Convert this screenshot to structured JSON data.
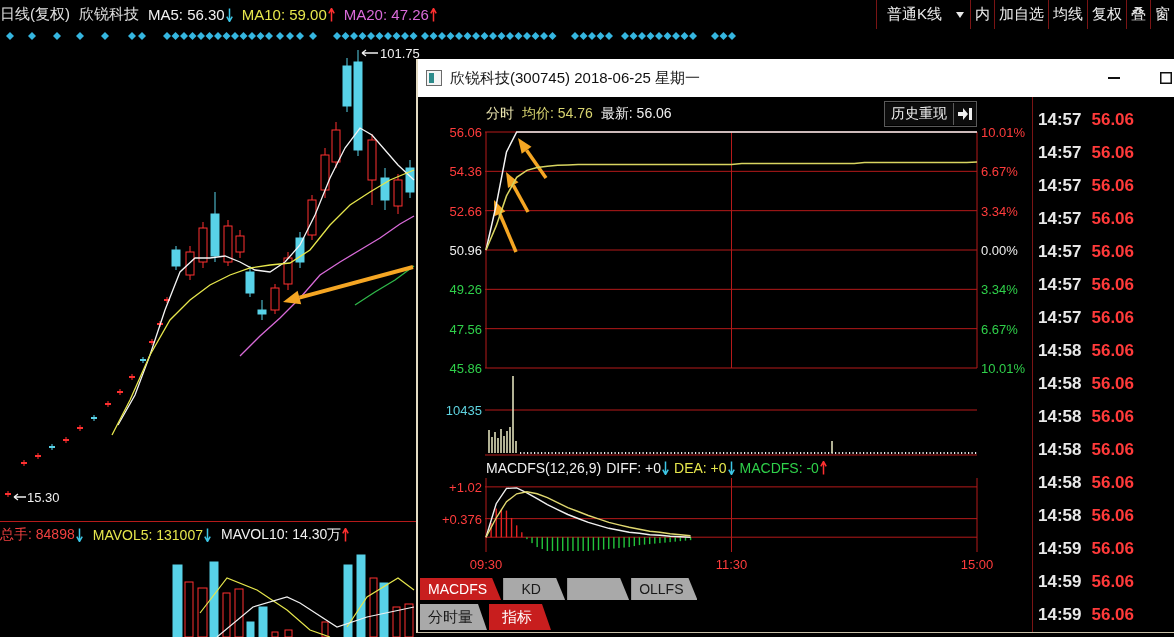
{
  "header": {
    "period": "日线(复权)",
    "stock": "欣锐科技",
    "indicators": [
      {
        "label": "MA5: 56.30",
        "rising": false,
        "color": "#f0f0f0"
      },
      {
        "label": "MA10: 59.00",
        "rising": true,
        "color": "#e6e64c"
      },
      {
        "label": "MA20: 47.26",
        "rising": true,
        "color": "#d86ad8"
      }
    ]
  },
  "toolbar": [
    {
      "label": "普通K线",
      "kind": "dropdown"
    },
    {
      "label": "内",
      "kind": "button"
    },
    {
      "label": "加自选",
      "kind": "button"
    },
    {
      "label": "均线",
      "kind": "button"
    },
    {
      "label": "复权",
      "kind": "button"
    },
    {
      "label": "叠",
      "kind": "button"
    },
    {
      "label": "窗",
      "kind": "button"
    }
  ],
  "kline": {
    "high_label": "101.75",
    "low_label": "15.30"
  },
  "volume": {
    "indicators": [
      {
        "label": "总手: 84898",
        "rising": false,
        "color": "#f04040"
      },
      {
        "label": "MAVOL5: 131007",
        "rising": false,
        "color": "#e6e64c"
      },
      {
        "label": "MAVOL10: 14.30万",
        "rising": true,
        "color": "#f0f0f0"
      }
    ]
  },
  "popup": {
    "title": "欣锐科技(300745) 2018-06-25 星期一",
    "summary": {
      "mode": "分时",
      "average": "均价: 54.76",
      "latest": "最新: 56.06"
    },
    "replay_button": "历史重现",
    "price_chart": {
      "chart_data": {
        "type": "line",
        "categories": [
          null,
          null,
          null,
          null,
          null,
          null,
          null,
          null,
          null,
          null,
          null,
          null,
          null,
          null,
          null,
          null,
          null,
          null,
          null,
          null,
          null,
          null,
          null,
          null,
          null,
          null,
          null,
          null,
          null,
          null,
          null,
          null,
          null,
          null,
          null,
          null,
          null,
          null,
          null,
          null,
          null,
          null,
          null,
          null,
          null,
          null,
          null,
          null,
          null
        ],
        "series": [
          {
            "color": "#f4f4f4",
            "values": [
              50.96,
              52.9,
              55.2,
              56.06,
              56.06,
              56.06,
              56.06,
              56.06,
              56.06,
              56.06,
              56.06,
              56.06,
              56.06,
              56.06,
              56.06,
              56.06,
              56.06,
              56.06,
              56.06,
              56.06,
              56.06,
              56.06,
              56.06,
              56.06,
              56.06,
              56.06,
              56.06,
              56.06,
              56.06,
              56.06,
              56.06,
              56.06,
              56.06,
              56.06,
              56.06,
              56.06,
              56.06,
              56.06,
              56.06,
              56.06,
              56.06,
              56.06,
              56.06,
              56.06,
              56.06,
              56.06,
              56.06,
              56.06,
              56.06
            ]
          },
          {
            "color": "#d8d460",
            "values": [
              50.96,
              52.0,
              53.3,
              54.1,
              54.4,
              54.52,
              54.58,
              54.62,
              54.64,
              54.66,
              54.66,
              54.66,
              54.66,
              54.66,
              54.66,
              54.66,
              54.66,
              54.66,
              54.66,
              54.66,
              54.66,
              54.66,
              54.66,
              54.66,
              54.66,
              54.7,
              54.7,
              54.7,
              54.7,
              54.7,
              54.7,
              54.7,
              54.7,
              54.7,
              54.7,
              54.7,
              54.7,
              54.74,
              54.74,
              54.74,
              54.74,
              54.74,
              54.74,
              54.74,
              54.74,
              54.74,
              54.74,
              54.74,
              54.76
            ]
          }
        ],
        "ylim": [
          45.86,
          56.06
        ],
        "yticks": [
          {
            "value": 56.06,
            "label": "56.06"
          },
          {
            "value": 54.36,
            "label": "54.36"
          },
          {
            "value": 52.66,
            "label": "52.66"
          },
          {
            "value": 50.96,
            "label": "50.96"
          },
          {
            "value": 49.26,
            "label": "49.26"
          },
          {
            "value": 47.56,
            "label": "47.56"
          },
          {
            "value": 45.86,
            "label": "45.86"
          }
        ],
        "grid": true
      },
      "change_labels": [
        "10.01%",
        "6.67%",
        "3.34%",
        "0.00%",
        "3.34%",
        "6.67%",
        "10.01%"
      ]
    },
    "volume_pane": {
      "max_label": "10435"
    },
    "macd": {
      "legend": [
        {
          "label": "MACDFS(12,26,9)",
          "color": "#f0f0f0"
        },
        {
          "label": "DIFF: +0",
          "rising": false,
          "color": "#f0f0f0"
        },
        {
          "label": "DEA: +0",
          "rising": false,
          "color": "#e6e64c"
        },
        {
          "label": "MACDFS: -0",
          "rising": true,
          "color": "#2fd04a"
        }
      ],
      "chart_data": {
        "type": "line",
        "categories": [
          "09:30",
          null,
          null,
          null,
          null,
          null,
          null,
          null,
          null,
          null,
          null,
          null,
          null,
          null,
          null,
          null,
          null,
          null,
          null,
          null,
          null,
          null,
          null,
          null,
          "11:30",
          null,
          null,
          null,
          null,
          null,
          null,
          null,
          null,
          null,
          null,
          null,
          null,
          null,
          null,
          null,
          null,
          null,
          null,
          null,
          null,
          null,
          null,
          null,
          "15:00"
        ],
        "series": [
          {
            "color": "#f0f0f0",
            "values": [
              0,
              0.68,
              0.99,
              1.0,
              0.9,
              0.78,
              0.66,
              0.56,
              0.46,
              0.38,
              0.3,
              0.24,
              0.18,
              0.14,
              0.1,
              0.08,
              0.05,
              0.04,
              0.02,
              0.01,
              0,
              null,
              null,
              null,
              null,
              null,
              null,
              null,
              null,
              null,
              null,
              null,
              null,
              null,
              null,
              null,
              null,
              null,
              null,
              null,
              null,
              null,
              null,
              null,
              null,
              null,
              null,
              null,
              null
            ]
          },
          {
            "color": "#e0d870",
            "values": [
              0,
              0.39,
              0.72,
              0.88,
              0.92,
              0.88,
              0.8,
              0.7,
              0.6,
              0.52,
              0.44,
              0.37,
              0.3,
              0.25,
              0.2,
              0.16,
              0.12,
              0.1,
              0.07,
              0.05,
              0.03,
              null,
              null,
              null,
              null,
              null,
              null,
              null,
              null,
              null,
              null,
              null,
              null,
              null,
              null,
              null,
              null,
              null,
              null,
              null,
              null,
              null,
              null,
              null,
              null,
              null,
              null,
              null,
              null
            ]
          }
        ],
        "ylim": [
          -0.3,
          1.2
        ],
        "yticks": [
          {
            "value": 1.02,
            "label": "+1.02"
          },
          {
            "value": 0.376,
            "label": "+0.376"
          }
        ],
        "grid": true
      }
    },
    "indicator_tabs": [
      {
        "label": "MACDFS",
        "selected": true
      },
      {
        "label": "KD",
        "selected": false
      },
      {
        "selected": false
      },
      {
        "label": "OLLFS",
        "selected": false
      }
    ],
    "pane_tabs": [
      {
        "label": "分时量",
        "selected": false
      },
      {
        "label": "指标",
        "selected": true
      }
    ],
    "ticks": [
      {
        "time": "14:57",
        "price": "56.06"
      },
      {
        "time": "14:57",
        "price": "56.06"
      },
      {
        "time": "14:57",
        "price": "56.06"
      },
      {
        "time": "14:57",
        "price": "56.06"
      },
      {
        "time": "14:57",
        "price": "56.06"
      },
      {
        "time": "14:57",
        "price": "56.06"
      },
      {
        "time": "14:57",
        "price": "56.06"
      },
      {
        "time": "14:58",
        "price": "56.06"
      },
      {
        "time": "14:58",
        "price": "56.06"
      },
      {
        "time": "14:58",
        "price": "56.06"
      },
      {
        "time": "14:58",
        "price": "56.06"
      },
      {
        "time": "14:58",
        "price": "56.06"
      },
      {
        "time": "14:58",
        "price": "56.06"
      },
      {
        "time": "14:59",
        "price": "56.06"
      },
      {
        "time": "14:59",
        "price": "56.06"
      },
      {
        "time": "14:59",
        "price": "56.06"
      }
    ]
  }
}
